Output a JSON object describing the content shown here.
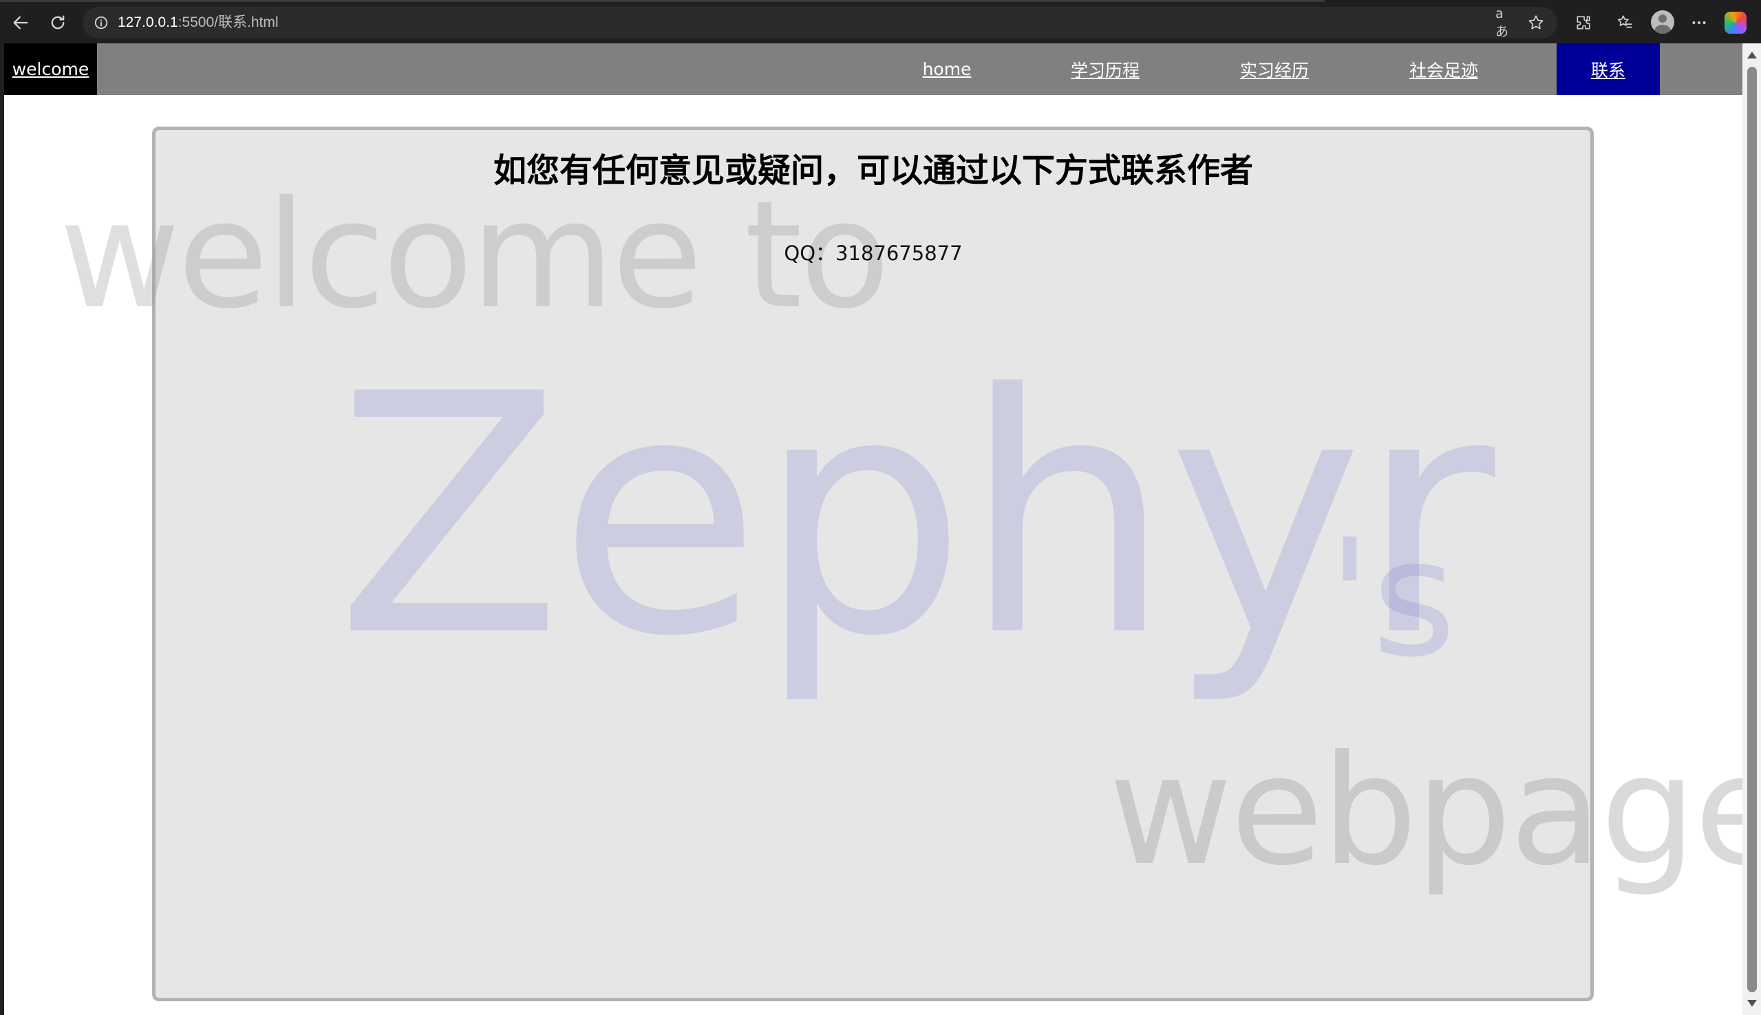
{
  "browser": {
    "url_host": "127.0.0.1",
    "url_rest": ":5500/联系.html",
    "read_aloud_label": "aあ"
  },
  "nav": {
    "brand": "welcome",
    "links": [
      "home",
      "学习历程",
      "实习经历",
      "社会足迹",
      "联系"
    ],
    "active": "联系"
  },
  "content": {
    "heading": "如您有任何意见或疑问，可以通过以下方式联系作者",
    "qq": "QQ：3187675877"
  },
  "watermark": {
    "line1": "welcome to",
    "name": "Zephyr",
    "possessive": "'s",
    "line3": "webpage"
  },
  "colors": {
    "nav_bg": "#808080",
    "brand_bg": "#000000",
    "active_bg": "#000099",
    "card_bg": "#e6e6e6"
  }
}
